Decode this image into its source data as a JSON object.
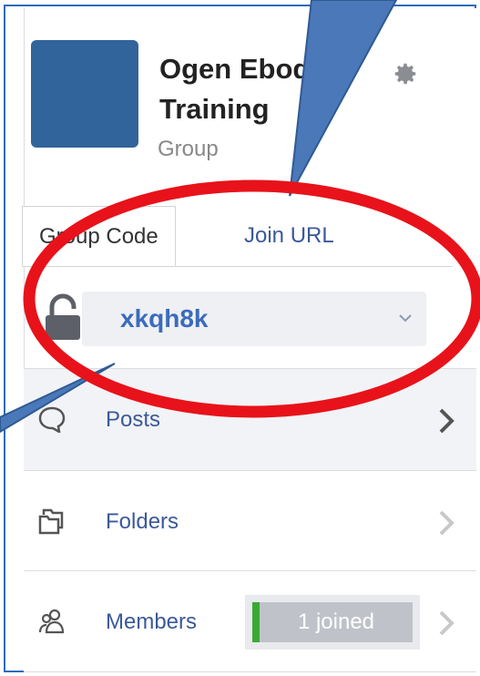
{
  "group": {
    "name": "Ogen Ebodo Training",
    "type": "Group"
  },
  "tabs": [
    {
      "label": "Group Code",
      "active": true
    },
    {
      "label": "Join URL",
      "active": false
    }
  ],
  "code": {
    "value": "xkqh8k",
    "icon": "lock-icon"
  },
  "nav": {
    "posts": {
      "label": "Posts",
      "icon": "speech-bubble-icon"
    },
    "folders": {
      "label": "Folders",
      "icon": "folder-icon"
    },
    "members": {
      "label": "Members",
      "icon": "members-icon",
      "badge": "1 joined"
    }
  },
  "colors": {
    "avatar": "#31649a",
    "link": "#3b5998",
    "code": "#3b6bbb",
    "highlight_ellipse": "#e8121a",
    "callout": "#4a78b8",
    "joined_bar": "#3aaa35"
  }
}
